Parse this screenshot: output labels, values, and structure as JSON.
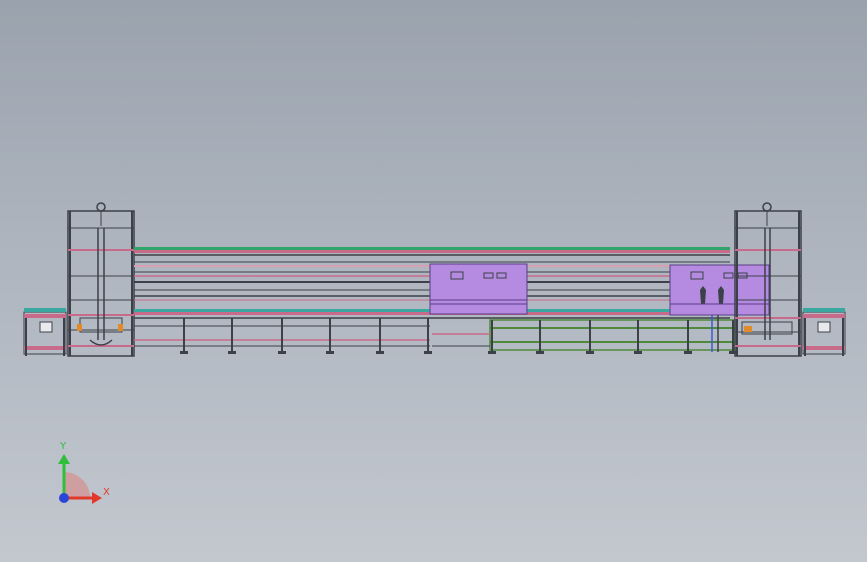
{
  "viewport": {
    "background_top": "#9aa2ad",
    "background_bottom": "#c3c8cf"
  },
  "model": {
    "frame_color": "#3c4048",
    "rail_pink": "#c86a8a",
    "rail_green": "#2fa56a",
    "rail_teal": "#3aa7a0",
    "cabinet_fill": "#b48be0",
    "cabinet_stroke": "#5a3e86",
    "floor_frame_green": "#4f8a3a",
    "blue_accent": "#3b5bd6",
    "orange_accent": "#e08a2a"
  },
  "triad": {
    "x_label": "X",
    "y_label": "Y",
    "x_color": "#e23a2a",
    "y_color": "#2fbf3a",
    "z_color": "#2a46d8",
    "arc_color": "#d98a8a"
  }
}
